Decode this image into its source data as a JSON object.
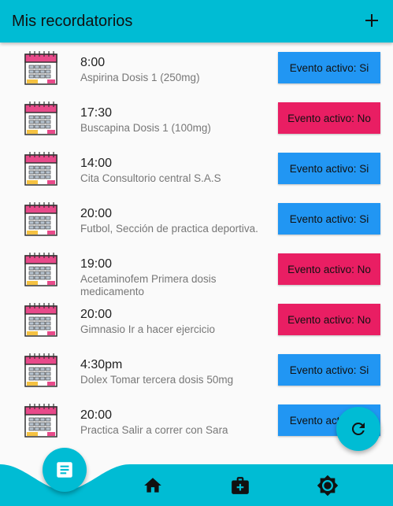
{
  "appbar": {
    "title": "Mis recordatorios",
    "add_icon": "plus-icon"
  },
  "colors": {
    "primary": "#00bcd4",
    "active": "#2196f3",
    "inactive": "#e91e63"
  },
  "reminders": [
    {
      "time": "8:00",
      "description": "Aspirina Dosis 1 (250mg)",
      "status": "Evento activo: Si",
      "active": true
    },
    {
      "time": "17:30",
      "description": "Buscapina Dosis 1 (100mg)",
      "status": "Evento activo: No",
      "active": false
    },
    {
      "time": "14:00",
      "description": "Cita Consultorio central S.A.S",
      "status": "Evento activo: Si",
      "active": true
    },
    {
      "time": "20:00",
      "description": "Futbol,  Sección de practica deportiva.",
      "status": "Evento activo: Si",
      "active": true
    },
    {
      "time": "19:00",
      "description": "Acetaminofem Primera dosis medicamento",
      "status": "Evento activo: No",
      "active": false
    },
    {
      "time": "20:00",
      "description": "Gimnasio Ir a hacer ejercicio",
      "status": "Evento activo: No",
      "active": false
    },
    {
      "time": "4:30pm",
      "description": "Dolex Tomar tercera dosis 50mg",
      "status": "Evento activo: Si",
      "active": true
    },
    {
      "time": "20:00",
      "description": "Practica Salir a correr con Sara",
      "status": "Evento activo: Si",
      "active": true
    }
  ],
  "fab": {
    "icon": "refresh-icon"
  },
  "bottom_nav": {
    "items": [
      "document-icon",
      "home-icon",
      "medical-kit-icon",
      "settings-icon"
    ]
  }
}
